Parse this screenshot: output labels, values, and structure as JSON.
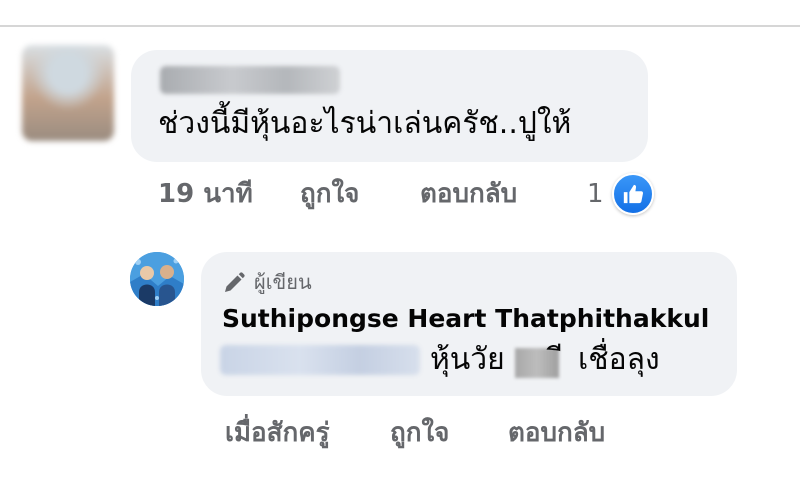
{
  "comment": {
    "text": "ช่วงนี้มีหุ้นอะไรน่าเล่นครัช..ปูให้",
    "actions": {
      "time": "19 นาที",
      "like": "ถูกใจ",
      "reply": "ตอบกลับ"
    },
    "reaction_count": "1"
  },
  "reply": {
    "author_label": "ผู้เขียน",
    "author_name": "Suthipongse Heart Thatphithakkul",
    "text_part1": "หุ้นวัย",
    "text_part2": "ี",
    "text_part3": "เชื่อลุง",
    "actions": {
      "time": "เมื่อสักครู่",
      "like": "ถูกใจ",
      "reply": "ตอบกลับ"
    }
  },
  "colors": {
    "like_blue": "#1877f2",
    "bubble_bg": "#f0f2f5",
    "secondary_text": "#65676b"
  }
}
